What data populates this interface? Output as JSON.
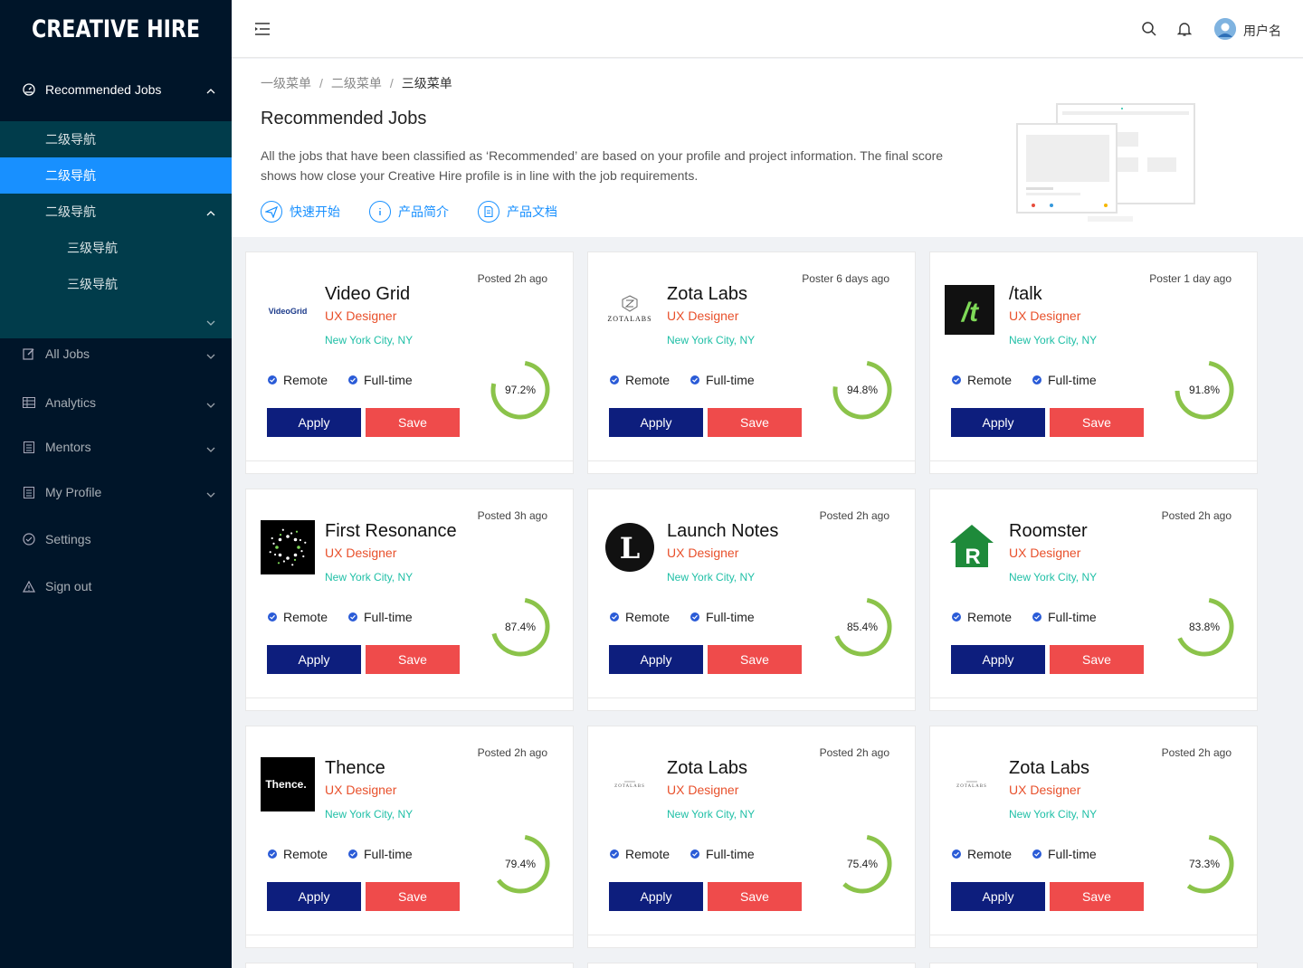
{
  "app": {
    "brand": "CREATIVE HIRE",
    "username": "用户名"
  },
  "sidebar": {
    "top": {
      "label": "Recommended Jobs",
      "icon": "dashboard-icon"
    },
    "sub": [
      {
        "label": "二级导航"
      },
      {
        "label": "二级导航",
        "active": true
      },
      {
        "label": "二级导航"
      }
    ],
    "sub3": [
      {
        "label": "三级导航"
      },
      {
        "label": "三级导航"
      }
    ],
    "items": [
      {
        "label": "All Jobs",
        "icon": "edit-icon"
      },
      {
        "label": "Analytics",
        "icon": "table-icon"
      },
      {
        "label": "Mentors",
        "icon": "list-icon"
      },
      {
        "label": "My Profile",
        "icon": "profile-icon"
      },
      {
        "label": "Settings",
        "icon": "check-circle-icon"
      },
      {
        "label": "Sign out",
        "icon": "warning-icon"
      }
    ]
  },
  "breadcrumb": [
    "一级菜单",
    "二级菜单",
    "三级菜单"
  ],
  "page": {
    "title": "Recommended Jobs",
    "description": "All the jobs that have been classified as ‘Recommended’ are based on your profile and project information. The final score shows how close your Creative Hire profile is in line with the job requirements.",
    "links": [
      {
        "label": "快速开始",
        "icon": "send-icon"
      },
      {
        "label": "产品简介",
        "icon": "info-icon"
      },
      {
        "label": "产品文档",
        "icon": "document-icon"
      }
    ]
  },
  "jobs": [
    {
      "company": "Video Grid",
      "logo_text": "VideoGrid",
      "role": "UX Designer",
      "location": "New York City, NY",
      "posted": "Posted 2h ago",
      "score": "97.2%",
      "score_value": 97.2
    },
    {
      "company": "Zota Labs",
      "logo_text": "ZOTALABS",
      "role": "UX Designer",
      "location": "New York City, NY",
      "posted": "Poster 6 days ago",
      "score": "94.8%",
      "score_value": 94.8
    },
    {
      "company": "/talk",
      "logo_text": "/t",
      "role": "UX Designer",
      "location": "New York City, NY",
      "posted": "Poster 1 day ago",
      "score": "91.8%",
      "score_value": 91.8
    },
    {
      "company": "First Resonance",
      "logo_text": "",
      "role": "UX Designer",
      "location": "New York City, NY",
      "posted": "Posted 3h ago",
      "score": "87.4%",
      "score_value": 87.4
    },
    {
      "company": "Launch Notes",
      "logo_text": "L",
      "role": "UX Designer",
      "location": "New York City, NY",
      "posted": "Posted 2h ago",
      "score": "85.4%",
      "score_value": 85.4
    },
    {
      "company": "Roomster",
      "logo_text": "R",
      "role": "UX Designer",
      "location": "New York City, NY",
      "posted": "Posted 2h ago",
      "score": "83.8%",
      "score_value": 83.8
    },
    {
      "company": "Thence",
      "logo_text": "Thence.",
      "role": "UX Designer",
      "location": "New York City, NY",
      "posted": "Posted 2h ago",
      "score": "79.4%",
      "score_value": 79.4
    },
    {
      "company": "Zota Labs",
      "logo_text": "ZOTALABS",
      "role": "UX Designer",
      "location": "New York City, NY",
      "posted": "Posted 2h ago",
      "score": "75.4%",
      "score_value": 75.4
    },
    {
      "company": "Zota Labs",
      "logo_text": "ZOTALABS",
      "role": "UX Designer",
      "location": "New York City, NY",
      "posted": "Posted 2h ago",
      "score": "73.3%",
      "score_value": 73.3
    }
  ],
  "card_labels": {
    "remote": "Remote",
    "fulltime": "Full-time",
    "apply": "Apply",
    "save": "Save"
  },
  "colors": {
    "sidebar_bg": "#001529",
    "submenu_bg": "#013c4b",
    "active": "#1890ff",
    "apply": "#0d1e7d",
    "save": "#ef4b4b",
    "role": "#e8502b",
    "location": "#1fbfa6",
    "score": "#8bc34a"
  }
}
